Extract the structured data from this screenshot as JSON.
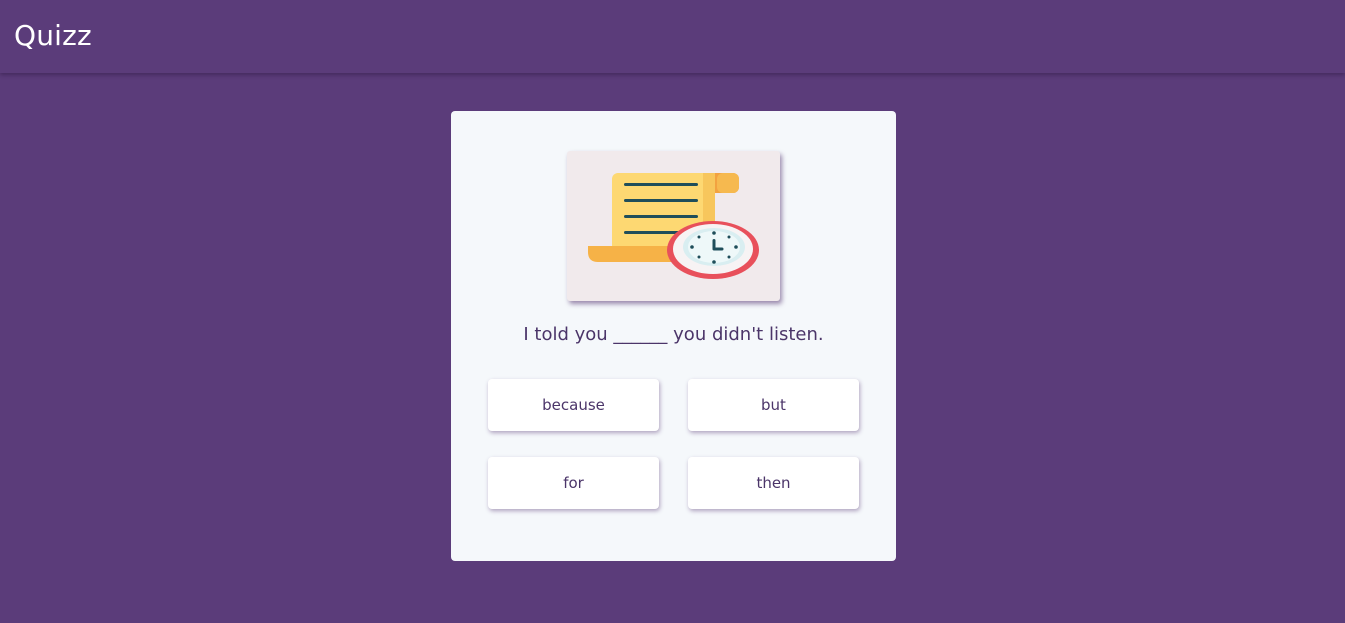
{
  "header": {
    "brand": "Quizz"
  },
  "quiz": {
    "illustration_icon": "scroll-with-clock-icon",
    "question": "I told you ______ you didn't listen.",
    "answers": [
      {
        "label": "because"
      },
      {
        "label": "but"
      },
      {
        "label": "for"
      },
      {
        "label": "then"
      }
    ]
  },
  "colors": {
    "background": "#5b3c7a",
    "card": "#f5f8fb",
    "text": "#4b3569"
  }
}
